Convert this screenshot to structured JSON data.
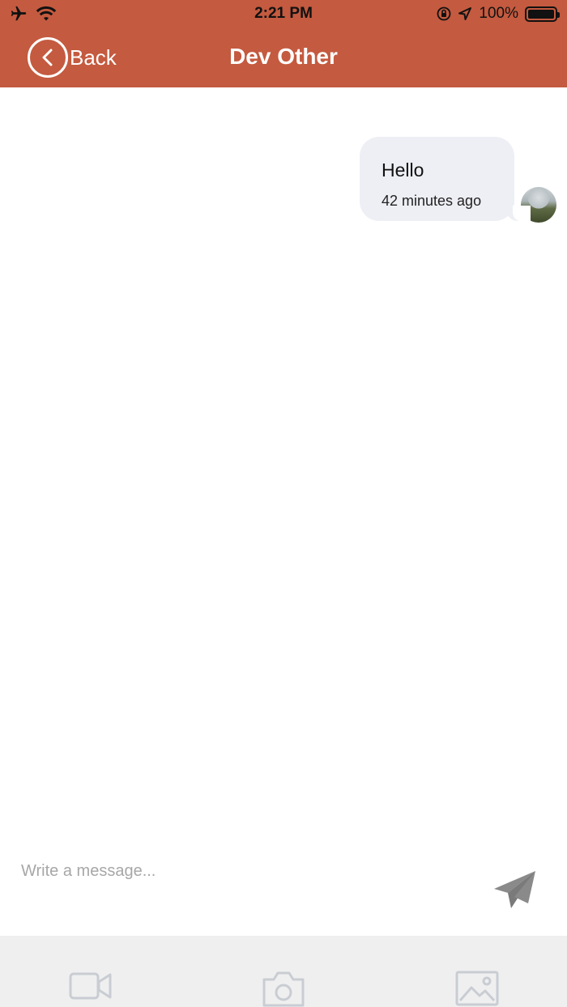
{
  "status_bar": {
    "time": "2:21 PM",
    "battery": "100%",
    "icons": [
      "airplane-icon",
      "wifi-icon",
      "rotation-lock-icon",
      "location-arrow-icon",
      "battery-icon"
    ]
  },
  "nav": {
    "back_label": "Back",
    "title": "Dev Other"
  },
  "colors": {
    "header": "#c45a3f",
    "bubble": "#eeeff4",
    "toolbar": "#efefef",
    "icon_gray": "#c9cdd3"
  },
  "messages": [
    {
      "text": "Hello",
      "time": "42 minutes ago",
      "sender": "me"
    }
  ],
  "composer": {
    "placeholder": "Write a message..."
  },
  "toolbar": {
    "icons": [
      "video-icon",
      "camera-icon",
      "image-icon"
    ]
  }
}
